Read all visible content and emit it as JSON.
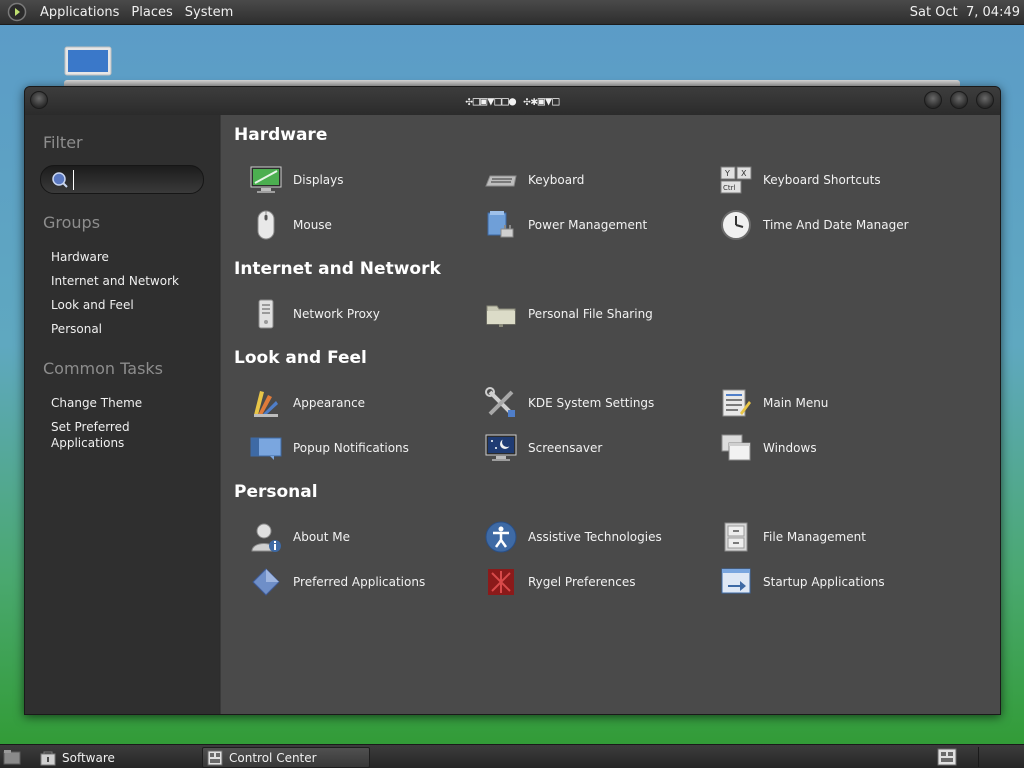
{
  "top_panel": {
    "menus": [
      "Applications",
      "Places",
      "System"
    ],
    "clock": "Sat Oct  7, 04:49"
  },
  "window": {
    "title": "✣□▣▼□□● ✣✱▣▼□"
  },
  "sidebar": {
    "filter_heading": "Filter",
    "search_value": "",
    "groups_heading": "Groups",
    "groups": [
      "Hardware",
      "Internet and Network",
      "Look and Feel",
      "Personal"
    ],
    "tasks_heading": "Common Tasks",
    "tasks": [
      "Change Theme",
      "Set Preferred Applications"
    ]
  },
  "sections": {
    "hardware": {
      "title": "Hardware",
      "items": [
        "Displays",
        "Keyboard",
        "Keyboard Shortcuts",
        "Mouse",
        "Power Management",
        "Time And Date Manager"
      ]
    },
    "internet": {
      "title": "Internet and Network",
      "items": [
        "Network Proxy",
        "Personal File Sharing"
      ]
    },
    "look": {
      "title": "Look and Feel",
      "items": [
        "Appearance",
        "KDE System Settings",
        "Main Menu",
        "Popup Notifications",
        "Screensaver",
        "Windows"
      ]
    },
    "personal": {
      "title": "Personal",
      "items": [
        "About Me",
        "Assistive Technologies",
        "File Management",
        "Preferred Applications",
        "Rygel Preferences",
        "Startup Applications"
      ]
    }
  },
  "taskbar": {
    "items": [
      "Software",
      "Control Center"
    ]
  }
}
